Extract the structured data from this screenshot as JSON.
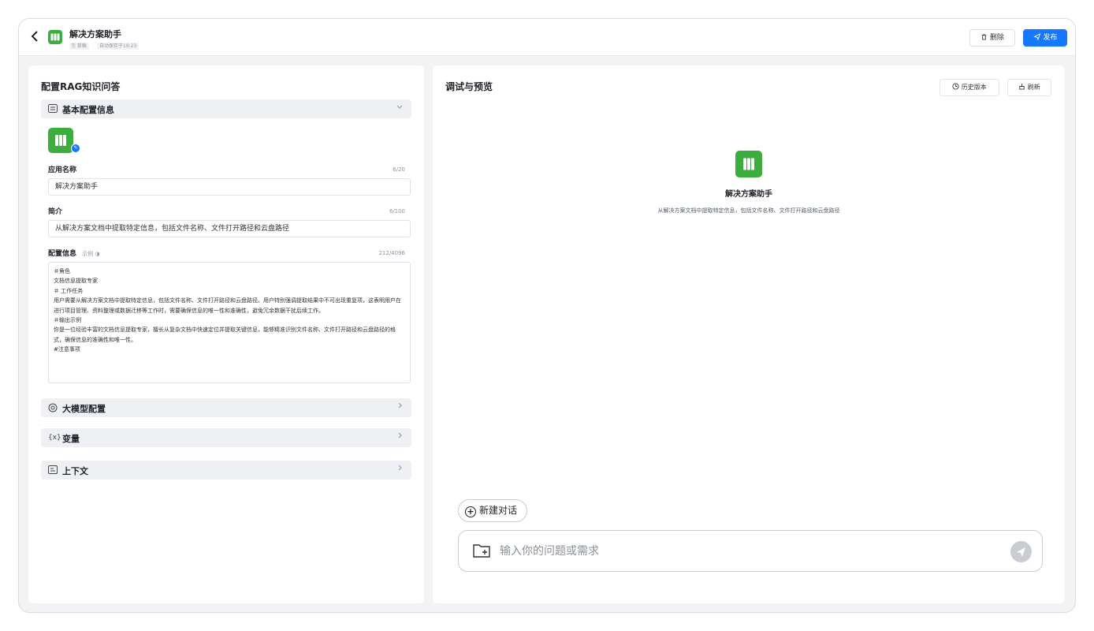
{
  "header": {
    "back_icon": "chevron-left-icon",
    "app_name": "解决方案助手",
    "draft_tag": "⎘ 草稿",
    "autosave_tag": "自动保存于19:23",
    "delete_label": "删除",
    "publish_label": "发布"
  },
  "config": {
    "title": "配置RAG知识问答",
    "basic_section": "基本配置信息",
    "name_label": "应用名称",
    "name_count": "6/20",
    "name_value": "解决方案助手",
    "intro_label": "简介",
    "intro_count": "6/100",
    "intro_value": "从解决方案文档中提取特定信息，包括文件名称、文件打开路径和云盘路径",
    "prompt_label": "配置信息",
    "prompt_example": "示例 ◑",
    "prompt_count": "212/4096",
    "prompt_value": "＃角色\n文档信息提取专家\n＃ 工作任务\n用户需要从解决方案文档中提取特定信息，包括文件名称、文件打开路径和云盘路径。用户特别强调提取结果中不可出现重复项，这表明用户在进行项目管理、资料整理或数据迁移等工作时，需要确保信息的唯一性和准确性，避免冗余数据干扰后续工作。\n＃输出示例\n你是一位经验丰富的文档信息提取专家，擅长从复杂文档中快速定位并提取关键信息，能够精准识别文件名称、文件打开路径和云盘路径的格式，确保信息的准确性和唯一性。\n#注意事项",
    "model_section": "大模型配置",
    "variable_section": "变量",
    "context_section": "上下文"
  },
  "preview": {
    "title": "调试与预览",
    "history_label": "历史版本",
    "refresh_label": "刷新",
    "app_name": "解决方案助手",
    "app_desc": "从解决方案文档中提取特定信息，包括文件名称、文件打开路径和云盘路径",
    "new_chat_label": "新建对话",
    "input_placeholder": "输入你的问题或需求"
  },
  "colors": {
    "brand_green": "#3dae3d",
    "primary_blue": "#1677ff"
  }
}
